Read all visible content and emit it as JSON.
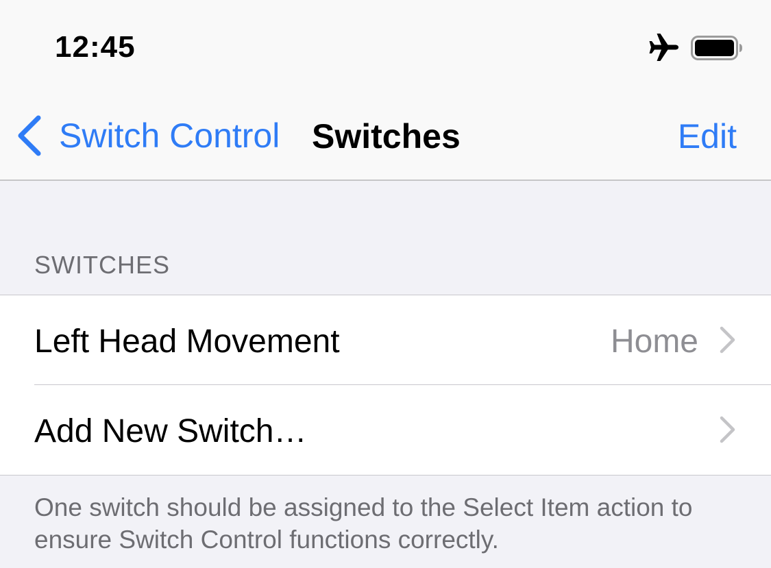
{
  "status_bar": {
    "time": "12:45",
    "icons": [
      "airplane-icon",
      "battery-icon"
    ]
  },
  "nav": {
    "back_label": "Switch Control",
    "title": "Switches",
    "edit_label": "Edit",
    "accent_color": "#2f7cf6"
  },
  "section": {
    "header": "SWITCHES",
    "rows": [
      {
        "label": "Left Head Movement",
        "value": "Home"
      },
      {
        "label": "Add New Switch…",
        "value": ""
      }
    ],
    "footer": "One switch should be assigned to the Select Item action to ensure Switch Control functions correctly."
  }
}
